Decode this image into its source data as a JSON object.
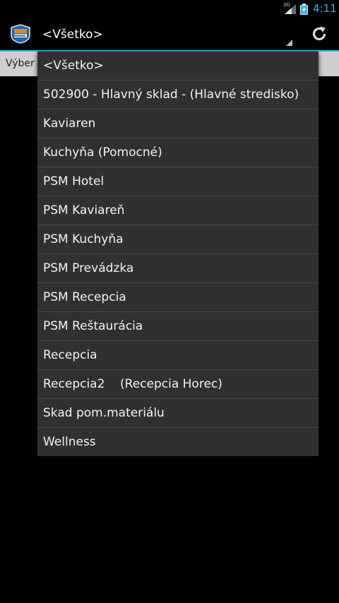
{
  "status_bar": {
    "network": "3G",
    "time": "4:11"
  },
  "action_bar": {
    "spinner_selected": "<Všetko>",
    "colors": {
      "accent": "#33b5e5",
      "background": "#000000"
    }
  },
  "sub_bar": {
    "label": "Výber p"
  },
  "dropdown": {
    "items": [
      {
        "label": "<Všetko>"
      },
      {
        "label": "502900 - Hlavný sklad - (Hlavné stredisko)"
      },
      {
        "label": "Kaviaren"
      },
      {
        "label": "Kuchyňa (Pomocné)"
      },
      {
        "label": "PSM Hotel"
      },
      {
        "label": "PSM Kaviareň"
      },
      {
        "label": "PSM Kuchyňa"
      },
      {
        "label": "PSM Prevádzka"
      },
      {
        "label": "PSM Recepcia"
      },
      {
        "label": "PSM Reštaurácia"
      },
      {
        "label": "Recepcia"
      },
      {
        "label": "Recepcia2    (Recepcia Horec)"
      },
      {
        "label": "Skad pom.materiálu"
      },
      {
        "label": "Wellness"
      }
    ]
  }
}
